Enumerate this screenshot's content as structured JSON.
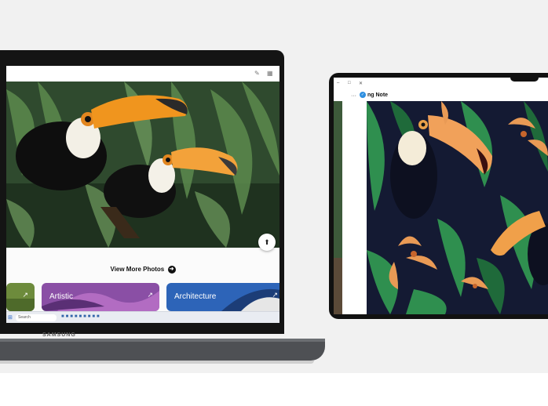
{
  "laptop": {
    "brand": "SAMSUNG",
    "browser_icons": [
      "pin-icon",
      "tabs-icon"
    ],
    "hero": {
      "save_icon": "save-icon"
    },
    "view_more": {
      "label": "View More Photos",
      "icon": "arrow-right-circle-icon"
    },
    "tiles": [
      {
        "label": "",
        "color": "#6d8b3c"
      },
      {
        "label": "Artistic",
        "color": "#8a4fa5"
      },
      {
        "label": "Architecture",
        "color": "#2d64b8"
      }
    ],
    "taskbar": {
      "search_placeholder": "Search",
      "tray_time": "",
      "tray_date": ""
    }
  },
  "tablet": {
    "app_title": "ng Note",
    "title_icon": "note-app-icon",
    "colors": {
      "background": "#141a33",
      "leaf": "#2f8f4f",
      "flower": "#e99a55"
    }
  },
  "colors": {
    "stage": "#f1f1f1",
    "laptop_frame": "#141414",
    "base": "#4e5054"
  }
}
